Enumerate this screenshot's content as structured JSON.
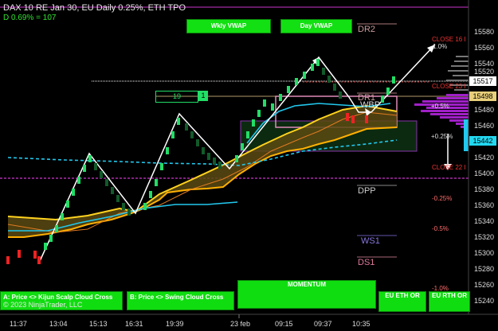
{
  "header": {
    "title": "DAX 10  RE Jan 30, EU Daily 0.25%, ETH TPO",
    "change": "D 0.69% = 107"
  },
  "buttons": {
    "wkly_vwap": "Wkly VWAP",
    "day_vwap": "Day VWAP",
    "kijun_line1": "A: Price <> Kijun Scalp Cloud Cross",
    "swing_line1": "B: Price <> Swing Cloud Cross",
    "momentum": "MOMENTUM",
    "eu_eth_or": "EU ETH OR",
    "eu_rth_or": "EU RTH OR"
  },
  "copyright": "© 2023 NinjaTrader, LLC",
  "counter": {
    "value": "19",
    "side": "1"
  },
  "levels": {
    "dr2": "DR2",
    "dr1": "DR1",
    "wbp": "WBP",
    "dpp": "DPP",
    "ws1": "WS1",
    "ds1": "DS1",
    "close16": "CLOSE 16 I",
    "close22": "CLOSE 22 I",
    "close_mid": "CLOSE 23 I"
  },
  "percent_labels": {
    "p10": "1.0%",
    "p05": "+0.5%",
    "p025": "+0.25%",
    "m025": "-0.25%",
    "m05": "-0.5%",
    "m10": "-1.0%"
  },
  "price_axis": {
    "ticks": [
      "15580",
      "15560",
      "15540",
      "15520",
      "15480",
      "15460",
      "15420",
      "15400",
      "15380",
      "15360",
      "15340",
      "15320",
      "15300",
      "15280",
      "15260",
      "15240"
    ],
    "current_price": "15517",
    "marker_yellow": "15498",
    "marker_cyan": "15442"
  },
  "time_axis": {
    "ticks": [
      "11:37",
      "13:04",
      "15:13",
      "16:31",
      "19:39",
      "23 feb",
      "09:15",
      "09:37",
      "10:35"
    ]
  },
  "colors": {
    "bull": "#22dd66",
    "bear": "#ee2222",
    "kijun": "#ffd21f",
    "vwap": "#22c8ee",
    "magenta": "#cc33cc",
    "cloud": "#6a5a12"
  }
}
